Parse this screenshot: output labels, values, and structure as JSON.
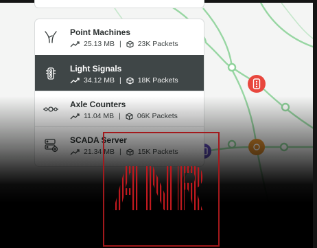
{
  "panel": {
    "items": [
      {
        "label": "Point Machines",
        "size": "25.13 MB",
        "packets": "23K Packets",
        "icon": "point-machine-icon",
        "active": false
      },
      {
        "label": "Light Signals",
        "size": "34.12 MB",
        "packets": "18K Packets",
        "icon": "traffic-light-icon",
        "active": true
      },
      {
        "label": "Axle Counters",
        "size": "11.04 MB",
        "packets": "06K Packets",
        "icon": "axle-counter-icon",
        "active": false
      },
      {
        "label": "SCADA Server",
        "size": "21.34 MB",
        "packets": "15K Packets",
        "icon": "server-icon",
        "active": false
      }
    ]
  },
  "logo": {
    "text": "ANR",
    "color": "#c0191e"
  },
  "colors": {
    "route": "#8ed39a",
    "node_signal": "#e8473d",
    "node_counter": "#d98a2c",
    "node_server": "#5b49b5",
    "active_row": "#3f4647"
  }
}
